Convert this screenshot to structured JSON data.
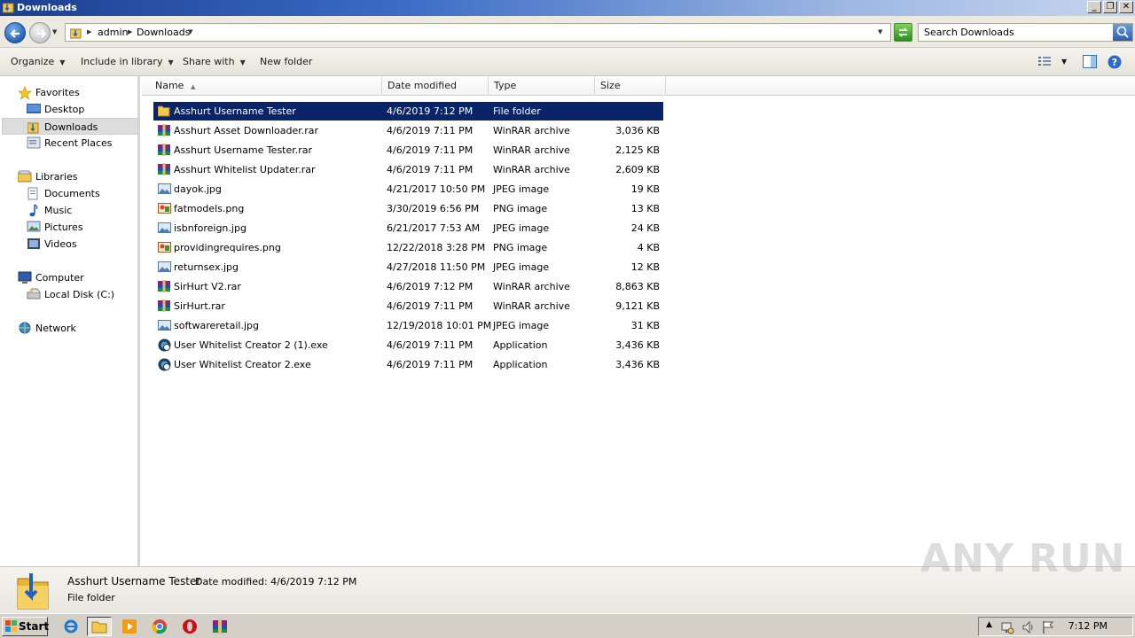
{
  "window": {
    "title": "Downloads",
    "buttons": [
      "_",
      "❐",
      "✕"
    ]
  },
  "address": {
    "crumbs": [
      "admin",
      "Downloads"
    ],
    "search_placeholder": "Search Downloads"
  },
  "toolbar": {
    "organize": "Organize",
    "include_in_library": "Include in library",
    "share_with": "Share with",
    "new_folder": "New folder"
  },
  "sidebar": {
    "favorites": "Favorites",
    "desktop": "Desktop",
    "downloads": "Downloads",
    "recent_places": "Recent Places",
    "libraries": "Libraries",
    "documents": "Documents",
    "music": "Music",
    "pictures": "Pictures",
    "videos": "Videos",
    "computer": "Computer",
    "local_disk": "Local Disk (C:)",
    "network": "Network"
  },
  "columns": {
    "name": "Name",
    "date_modified": "Date modified",
    "type": "Type",
    "size": "Size"
  },
  "files": [
    {
      "name": "Asshurt Username Tester",
      "date": "4/6/2019 7:12 PM",
      "type": "File folder",
      "size": "",
      "icon": "folder-icon",
      "selected": true
    },
    {
      "name": "Asshurt Asset Downloader.rar",
      "date": "4/6/2019 7:11 PM",
      "type": "WinRAR archive",
      "size": "3,036 KB",
      "icon": "winrar-icon"
    },
    {
      "name": "Asshurt Username Tester.rar",
      "date": "4/6/2019 7:11 PM",
      "type": "WinRAR archive",
      "size": "2,125 KB",
      "icon": "winrar-icon"
    },
    {
      "name": "Asshurt Whitelist Updater.rar",
      "date": "4/6/2019 7:11 PM",
      "type": "WinRAR archive",
      "size": "2,609 KB",
      "icon": "winrar-icon"
    },
    {
      "name": "dayok.jpg",
      "date": "4/21/2017 10:50 PM",
      "type": "JPEG image",
      "size": "19 KB",
      "icon": "jpeg-icon"
    },
    {
      "name": "fatmodels.png",
      "date": "3/30/2019 6:56 PM",
      "type": "PNG image",
      "size": "13 KB",
      "icon": "png-icon"
    },
    {
      "name": "isbnforeign.jpg",
      "date": "6/21/2017 7:53 AM",
      "type": "JPEG image",
      "size": "24 KB",
      "icon": "jpeg-icon"
    },
    {
      "name": "providingrequires.png",
      "date": "12/22/2018 3:28 PM",
      "type": "PNG image",
      "size": "4 KB",
      "icon": "png-icon"
    },
    {
      "name": "returnsex.jpg",
      "date": "4/27/2018 11:50 PM",
      "type": "JPEG image",
      "size": "12 KB",
      "icon": "jpeg-icon"
    },
    {
      "name": "SirHurt V2.rar",
      "date": "4/6/2019 7:12 PM",
      "type": "WinRAR archive",
      "size": "8,863 KB",
      "icon": "winrar-icon"
    },
    {
      "name": "SirHurt.rar",
      "date": "4/6/2019 7:11 PM",
      "type": "WinRAR archive",
      "size": "9,121 KB",
      "icon": "winrar-icon"
    },
    {
      "name": "softwareretail.jpg",
      "date": "12/19/2018 10:01 PM",
      "type": "JPEG image",
      "size": "31 KB",
      "icon": "jpeg-icon"
    },
    {
      "name": "User Whitelist Creator 2 (1).exe",
      "date": "4/6/2019 7:11 PM",
      "type": "Application",
      "size": "3,436 KB",
      "icon": "exe-icon"
    },
    {
      "name": "User Whitelist Creator 2.exe",
      "date": "4/6/2019 7:11 PM",
      "type": "Application",
      "size": "3,436 KB",
      "icon": "exe-icon"
    }
  ],
  "details": {
    "name": "Asshurt Username Tester",
    "date_modified": "Date modified: 4/6/2019 7:12 PM",
    "type": "File folder"
  },
  "watermark": "ANY RUN",
  "taskbar": {
    "start": "Start",
    "clock": "7:12 PM"
  }
}
